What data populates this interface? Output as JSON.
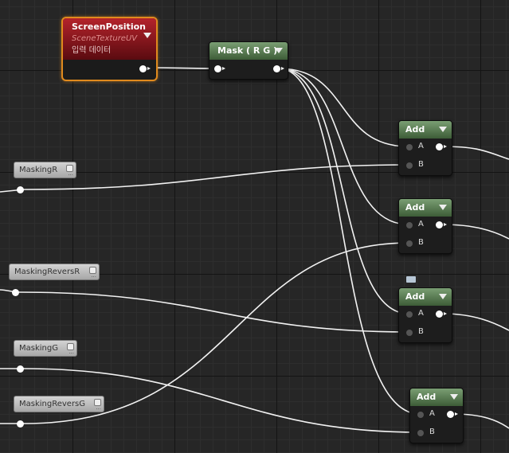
{
  "nodes": {
    "screen_position": {
      "title": "ScreenPosition",
      "subtitle": "SceneTextureUV",
      "subtitle2": "입력 데이터"
    },
    "mask": {
      "title": "Mask ( R G )"
    },
    "add_nodes": [
      {
        "title": "Add",
        "pin_a": "A",
        "pin_b": "B"
      },
      {
        "title": "Add",
        "pin_a": "A",
        "pin_b": "B"
      },
      {
        "title": "Add",
        "pin_a": "A",
        "pin_b": "B"
      },
      {
        "title": "Add",
        "pin_a": "A",
        "pin_b": "B"
      }
    ]
  },
  "parameters": [
    {
      "label": "MaskingR"
    },
    {
      "label": "MaskingReversR"
    },
    {
      "label": "MaskingG"
    },
    {
      "label": "MaskingReversG"
    }
  ],
  "icons": {
    "dropdown": "caret-down-icon",
    "comment": "comment-bubble-icon"
  },
  "colors": {
    "selection": "#e08a1e",
    "math_header": "#5c7f55",
    "texture_header": "#a31d24",
    "wire": "#f2f2f2",
    "background": "#262626"
  }
}
